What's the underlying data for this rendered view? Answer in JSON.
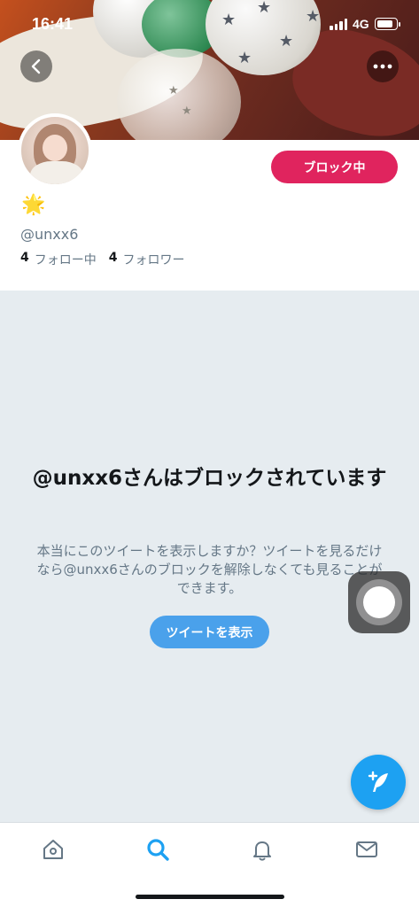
{
  "status_bar": {
    "time": "16:41",
    "network": "4G"
  },
  "header": {
    "back_icon": "chevron-left-icon",
    "more_icon": "ellipsis-icon"
  },
  "profile": {
    "block_button_label": "ブロック中",
    "badge_emoji": "🌟",
    "handle": "@unxx6",
    "following_count": "4",
    "following_label": "フォロー中",
    "followers_count": "4",
    "followers_label": "フォロワー"
  },
  "blocked": {
    "title": "@unxx6さんはブロックされています",
    "description": "本当にこのツイートを表示しますか？ツイートを見るだけなら@unxx6さんのブロックを解除しなくても見ることができます。",
    "view_button_label": "ツイートを表示"
  },
  "colors": {
    "block_red": "#e0245e",
    "twitter_blue": "#1da1f2",
    "button_blue": "#4aa1eb",
    "gray_text": "#657786"
  },
  "tabs": [
    {
      "icon": "home-icon",
      "active": false
    },
    {
      "icon": "search-icon",
      "active": true
    },
    {
      "icon": "bell-icon",
      "active": false
    },
    {
      "icon": "mail-icon",
      "active": false
    }
  ]
}
